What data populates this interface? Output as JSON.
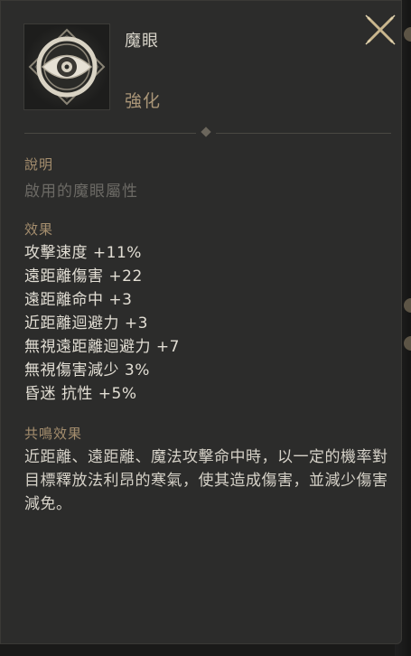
{
  "item": {
    "name": "魔眼",
    "grade": "強化",
    "icon": "eye-icon"
  },
  "close": {
    "icon": "close-x-icon"
  },
  "description": {
    "title": "說明",
    "text": "啟用的魔眼屬性"
  },
  "effects": {
    "title": "效果",
    "items": [
      "攻擊速度 +11%",
      "遠距離傷害 +22",
      "遠距離命中 +3",
      "近距離迴避力 +3",
      "無視遠距離迴避力 +7",
      "無視傷害減少 3%",
      "昏迷 抗性 +5%"
    ]
  },
  "resonance": {
    "title": "共鳴效果",
    "text": "近距離、遠距離、魔法攻擊命中時，以一定的機率對目標釋放法利昂的寒氣，使其造成傷害，並減少傷害減免。"
  },
  "colors": {
    "panel_bg": "#2c2c2b",
    "section_title": "#a58e6e",
    "grade": "#a99577",
    "muted_text": "#6c6a65",
    "body_text": "#e2ded4",
    "close_gold": "#c9b68d"
  }
}
